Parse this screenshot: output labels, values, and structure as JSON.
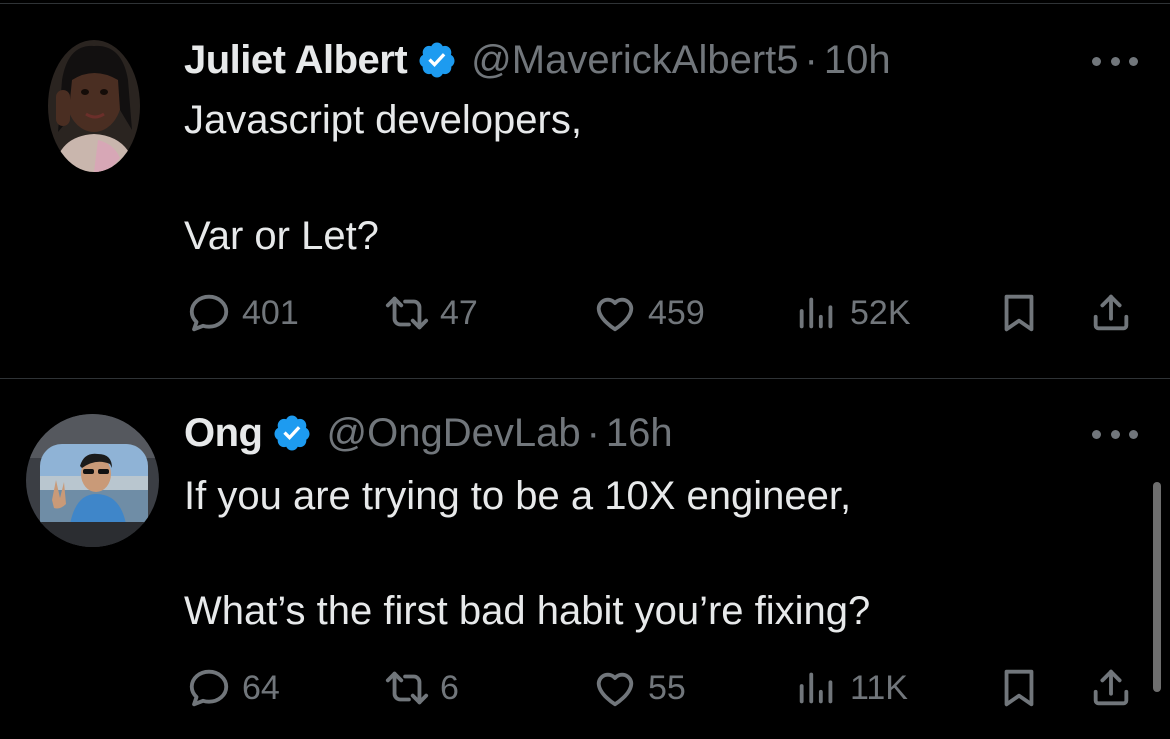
{
  "tweets": [
    {
      "name": "Juliet Albert",
      "handle": "@MaverickAlbert5",
      "dot": "·",
      "time": "10h",
      "lines": [
        "Javascript developers,",
        "Var or Let?"
      ],
      "replies": "401",
      "retweets": "47",
      "likes": "459",
      "views": "52K"
    },
    {
      "name": "Ong",
      "handle": "@OngDevLab",
      "dot": "·",
      "time": "16h",
      "lines": [
        "If you are trying to be a 10X engineer,",
        "What’s the first bad habit you’re fixing?"
      ],
      "replies": "64",
      "retweets": "6",
      "likes": "55",
      "views": "11K"
    }
  ],
  "icons": {
    "verified": "verified-badge-icon",
    "reply": "reply-icon",
    "retweet": "retweet-icon",
    "like": "heart-icon",
    "views": "views-icon",
    "bookmark": "bookmark-icon",
    "share": "share-icon",
    "more": "more-icon"
  },
  "colors": {
    "background": "#000000",
    "primary_text": "#e7e9ea",
    "secondary_text": "#71767b",
    "verified": "#1d9bf0",
    "divider": "#2f3336"
  }
}
